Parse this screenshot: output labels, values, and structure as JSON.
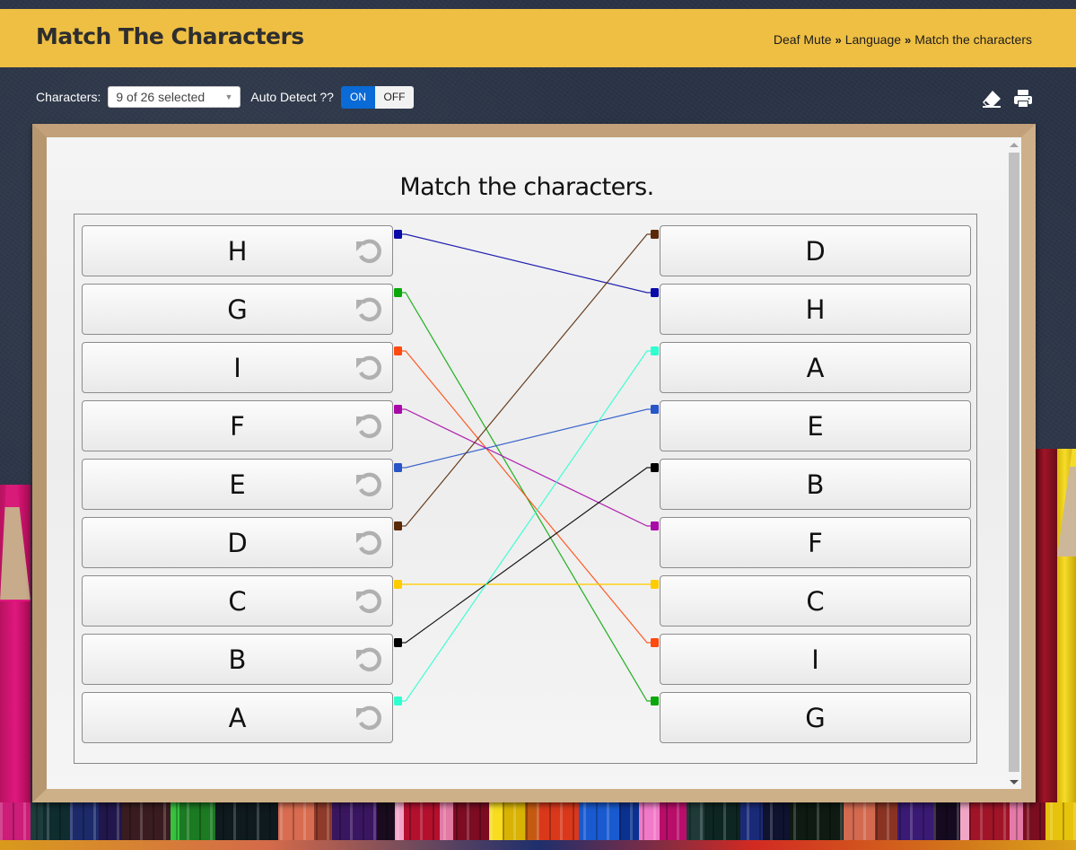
{
  "header": {
    "title": "Match The Characters",
    "breadcrumb": [
      {
        "label": "Deaf Mute"
      },
      {
        "label": "Language"
      },
      {
        "label": "Match the characters"
      }
    ],
    "breadcrumb_separator": "»"
  },
  "toolbar": {
    "characters_label": "Characters:",
    "characters_select_value": "9 of 26 selected",
    "auto_detect_label": "Auto Detect ??",
    "toggle_on": "ON",
    "toggle_off": "OFF",
    "toggle_state": "ON",
    "eraser_icon": "eraser-icon",
    "print_icon": "print-icon"
  },
  "board": {
    "title": "Match the characters.",
    "left_items": [
      "H",
      "G",
      "I",
      "F",
      "E",
      "D",
      "C",
      "B",
      "A"
    ],
    "right_items": [
      "D",
      "H",
      "A",
      "E",
      "B",
      "F",
      "C",
      "I",
      "G"
    ],
    "connections": [
      {
        "left": "H",
        "right": "H",
        "color": "#0a0aa8"
      },
      {
        "left": "G",
        "right": "G",
        "color": "#0aa80a"
      },
      {
        "left": "I",
        "right": "I",
        "color": "#ff4a10"
      },
      {
        "left": "F",
        "right": "F",
        "color": "#a80aa8"
      },
      {
        "left": "E",
        "right": "E",
        "color": "#2855c8"
      },
      {
        "left": "D",
        "right": "D",
        "color": "#5a2a08"
      },
      {
        "left": "C",
        "right": "C",
        "color": "#ffcc00"
      },
      {
        "left": "B",
        "right": "B",
        "color": "#000000"
      },
      {
        "left": "A",
        "right": "A",
        "color": "#30ffd0"
      }
    ],
    "reset_icon": "undo-icon"
  },
  "colors": {
    "header_bg": "#efbf43",
    "toggle_on_bg": "#0a6ad6",
    "frame": "#c4a77f"
  }
}
